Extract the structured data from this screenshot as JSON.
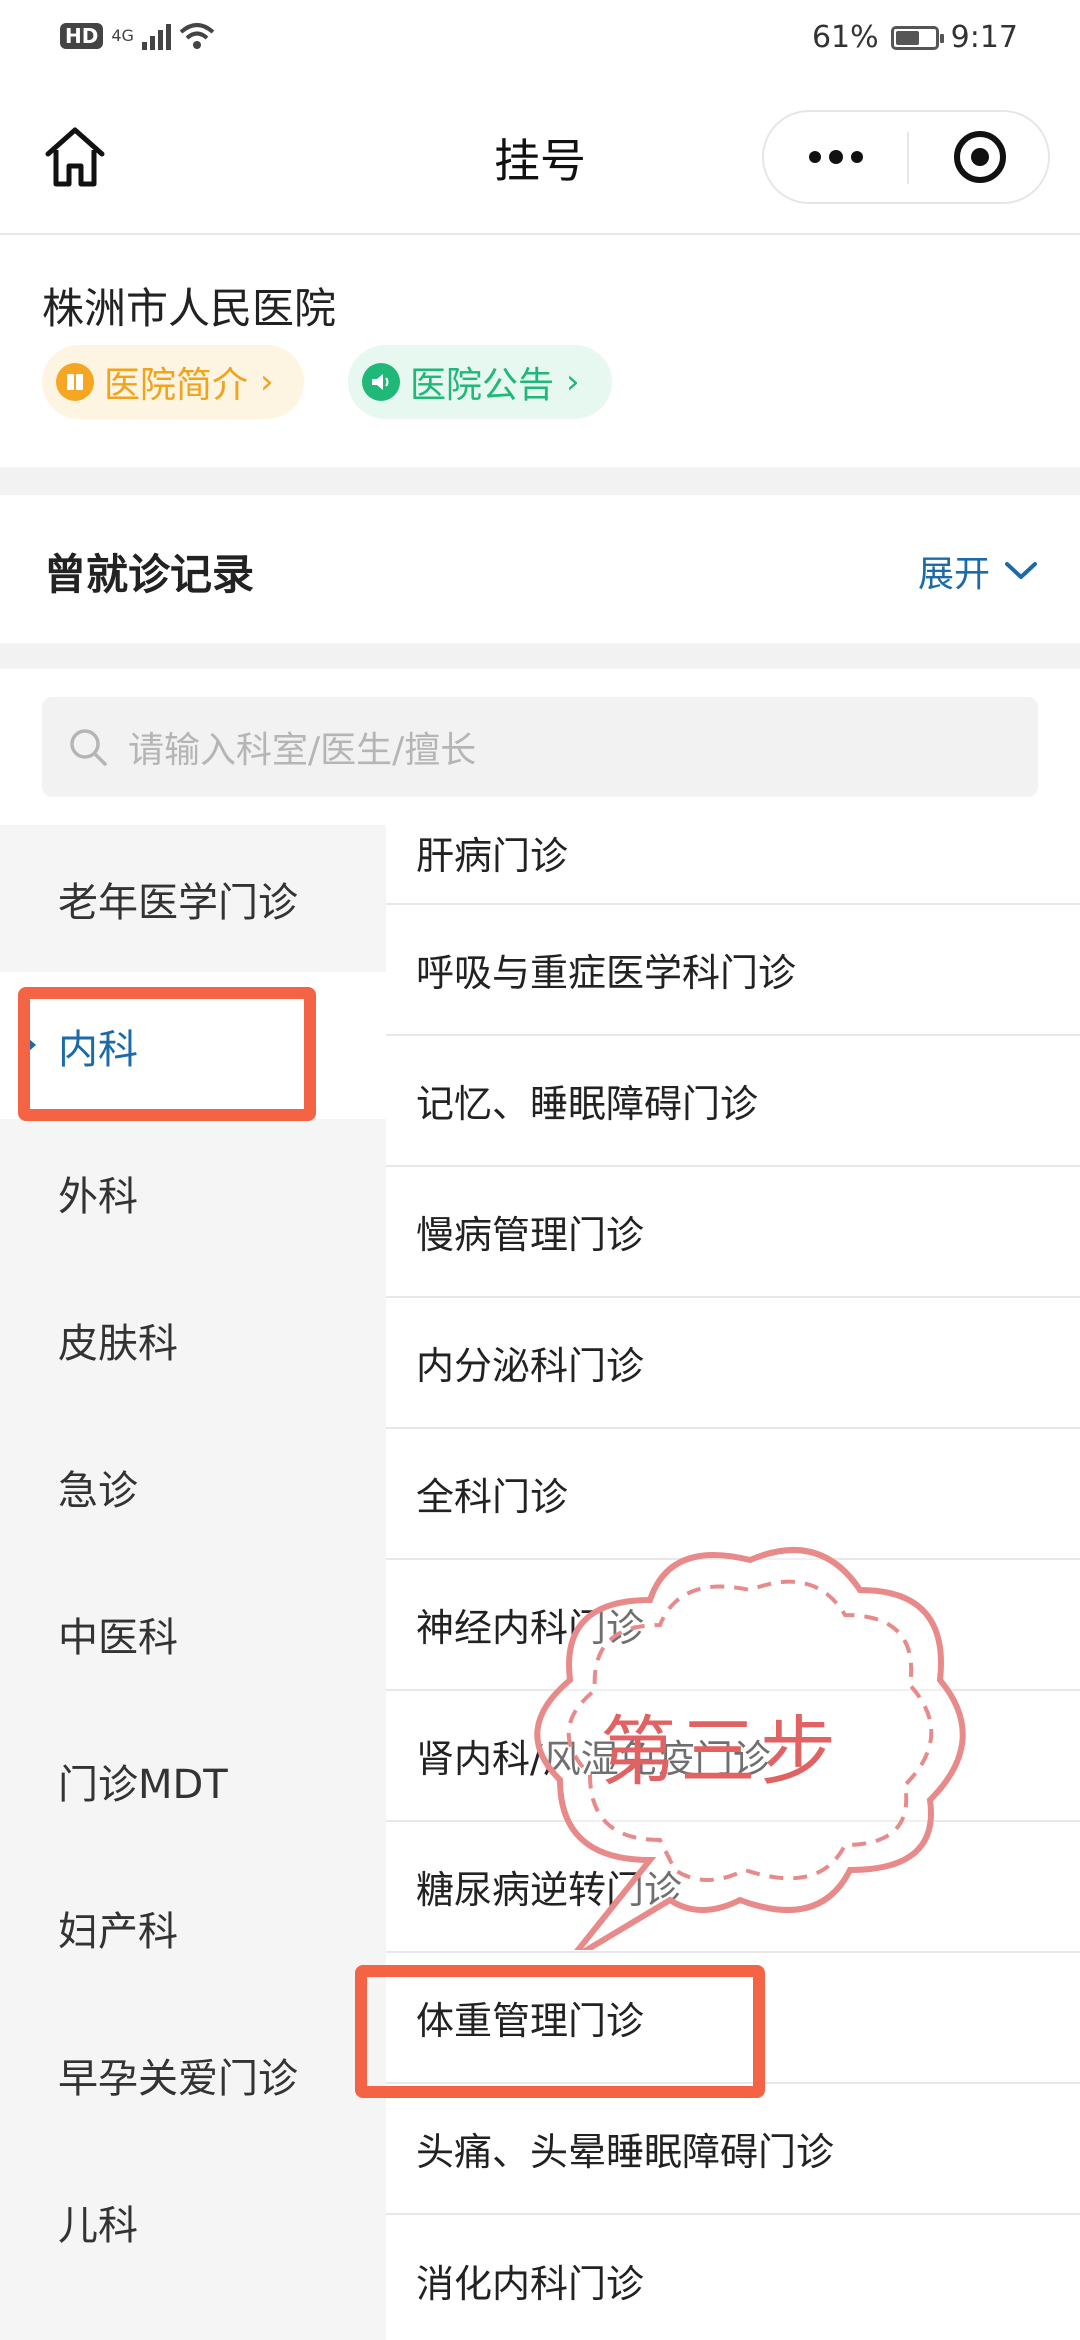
{
  "status_bar": {
    "network_badge": "HD",
    "network_type": "4G",
    "battery_percent": "61%",
    "battery_level": 0.61,
    "time": "9:17"
  },
  "navbar": {
    "title": "挂号",
    "icons": [
      "home-icon",
      "more-icon",
      "close-icon"
    ]
  },
  "hospital": {
    "name": "株洲市人民医院",
    "intro_label": "医院简介",
    "notice_label": "医院公告",
    "arrow": "›",
    "colors": {
      "intro": "#f1a31c",
      "notice": "#1fb879"
    }
  },
  "records": {
    "title": "曾就诊记录",
    "expand_label": "展开"
  },
  "search": {
    "placeholder": "请输入科室/医生/擅长"
  },
  "departments": [
    "老年医学门诊",
    "内科",
    "外科",
    "皮肤科",
    "急诊",
    "中医科",
    "门诊MDT",
    "妇产科",
    "早孕关爱门诊",
    "儿科"
  ],
  "active_department": "内科",
  "clinics": [
    "肝病门诊",
    "呼吸与重症医学科门诊",
    "记忆、睡眠障碍门诊",
    "慢病管理门诊",
    "内分泌科门诊",
    "全科门诊",
    "神经内科门诊",
    "肾内科/风湿免疫门诊",
    "糖尿病逆转门诊",
    "体重管理门诊",
    "头痛、头晕睡眠障碍门诊",
    "消化内科门诊"
  ],
  "annotation": {
    "step_label": "第三步",
    "highlight_color": "#f36344"
  }
}
